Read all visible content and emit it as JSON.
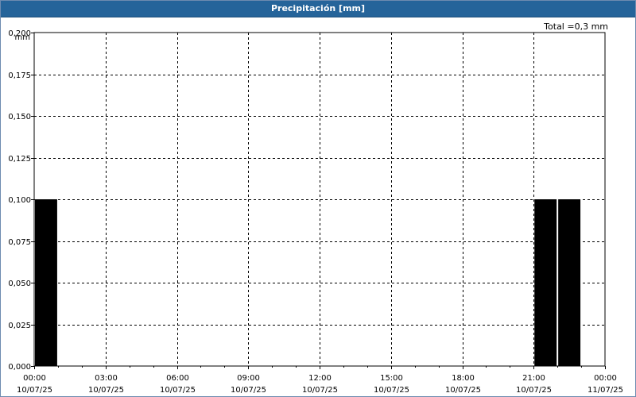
{
  "window": {
    "title": "Precipitación [mm]"
  },
  "summary": {
    "total_label": "Total =0,3 mm"
  },
  "chart_data": {
    "type": "bar",
    "title": "Precipitación [mm]",
    "ylabel": "mm",
    "xlabel": "",
    "ylim": [
      0,
      0.2
    ],
    "yticks": [
      "0,000",
      "0,025",
      "0,050",
      "0,075",
      "0,100",
      "0,125",
      "0,150",
      "0,175",
      "0,200"
    ],
    "xticks": [
      {
        "time": "00:00",
        "date": "10/07/25"
      },
      {
        "time": "03:00",
        "date": "10/07/25"
      },
      {
        "time": "06:00",
        "date": "10/07/25"
      },
      {
        "time": "09:00",
        "date": "10/07/25"
      },
      {
        "time": "12:00",
        "date": "10/07/25"
      },
      {
        "time": "15:00",
        "date": "10/07/25"
      },
      {
        "time": "18:00",
        "date": "10/07/25"
      },
      {
        "time": "21:00",
        "date": "10/07/25"
      },
      {
        "time": "00:00",
        "date": "11/07/25"
      }
    ],
    "xrange": [
      "10/07/25 00:00",
      "11/07/25 00:00"
    ],
    "bar_interval_hours": 1,
    "bars": [
      {
        "start": "10/07/25 00:00",
        "value": 0.1
      },
      {
        "start": "10/07/25 21:00",
        "value": 0.1
      },
      {
        "start": "10/07/25 22:00",
        "value": 0.1
      }
    ],
    "bar_color": "#000000",
    "grid": true,
    "total": 0.3
  }
}
